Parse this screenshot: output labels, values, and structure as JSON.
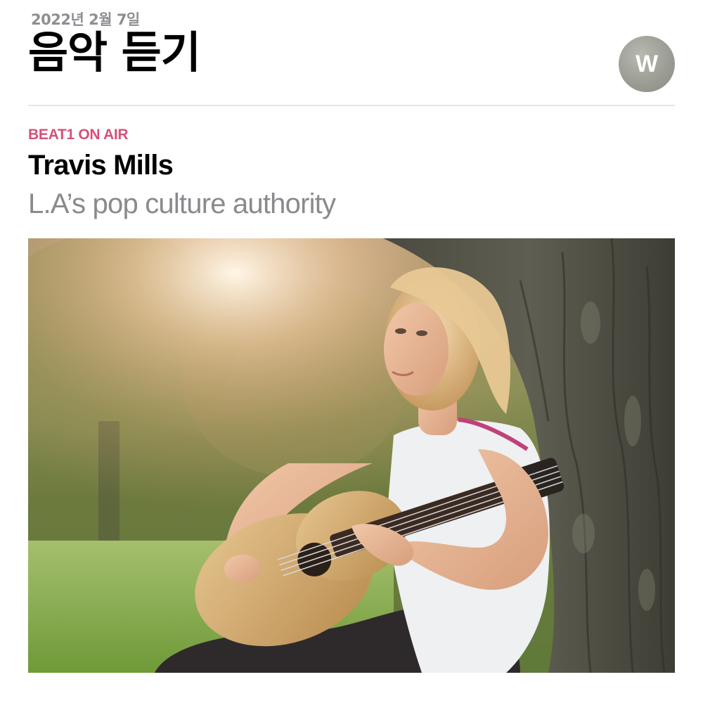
{
  "header": {
    "date": "2022년 2월 7일",
    "title": "음악 듣기",
    "avatar_letter": "W"
  },
  "card": {
    "kicker": "BEAT1 ON AIR",
    "title": "Travis Mills",
    "subtitle": "L.A’s pop culture authority",
    "image_description_icon": "photo-woman-guitar"
  },
  "colors": {
    "kicker": "#d6517a",
    "divider": "#e5e5ea",
    "avatar": "#9c9d94"
  }
}
